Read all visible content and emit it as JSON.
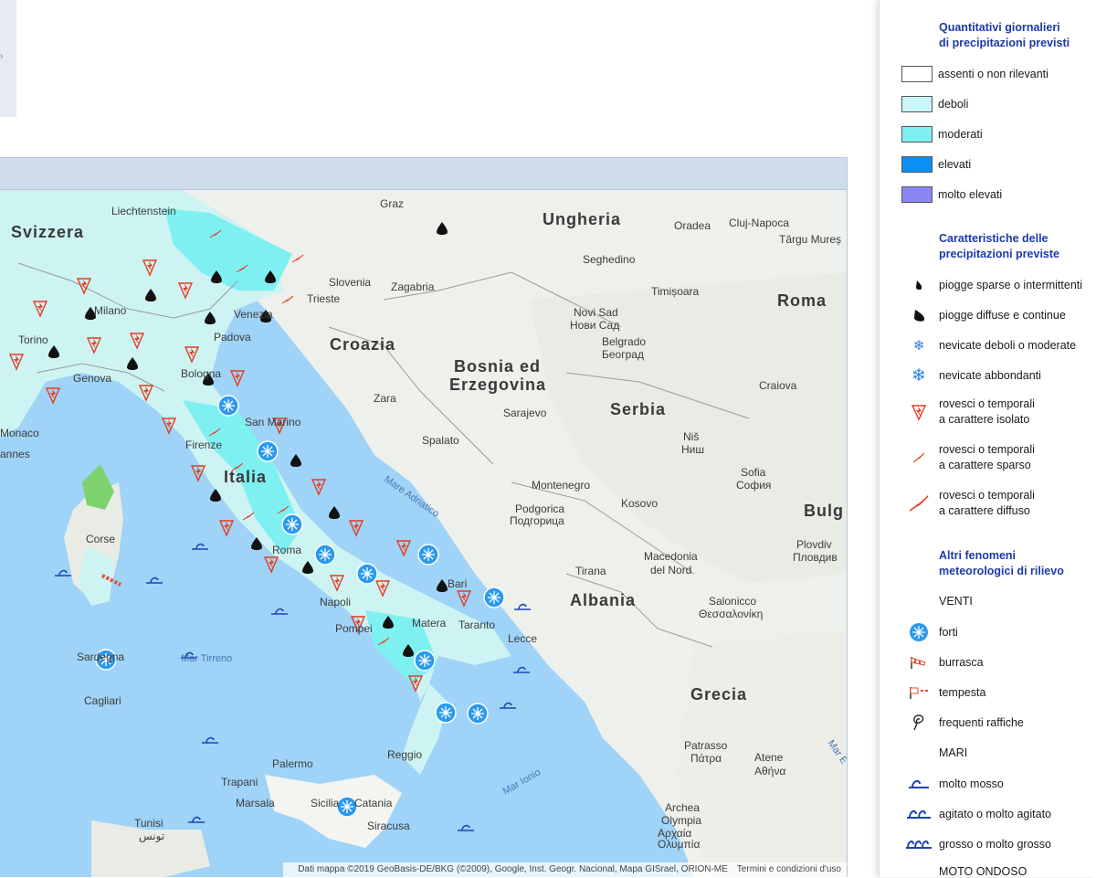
{
  "legend": {
    "quantity_title_1": "Quantitativi giornalieri",
    "quantity_title_2": "di precipitazioni previsti",
    "quantity_items": [
      {
        "label": "assenti o non rilevanti",
        "color": "#ffffff"
      },
      {
        "label": "deboli",
        "color": "#c9f6f8"
      },
      {
        "label": "moderati",
        "color": "#7ff0f2"
      },
      {
        "label": "elevati",
        "color": "#0b8ff2"
      },
      {
        "label": "molto elevati",
        "color": "#8a86f2"
      }
    ],
    "features_title_1": "Caratteristiche delle",
    "features_title_2": "precipitazioni previste",
    "features_items": [
      {
        "icon": "drop-small-icon",
        "line1": "piogge sparse o intermittenti",
        "line2": ""
      },
      {
        "icon": "drop-large-icon",
        "line1": "piogge diffuse e continue",
        "line2": ""
      },
      {
        "icon": "snowflake-small-icon",
        "line1": "nevicate deboli o moderate",
        "line2": ""
      },
      {
        "icon": "snowflake-large-icon",
        "line1": "nevicate abbondanti",
        "line2": ""
      },
      {
        "icon": "thunder-isolated-icon",
        "line1": "rovesci o temporali",
        "line2": "a carattere isolato"
      },
      {
        "icon": "thunder-scattered-icon",
        "line1": "rovesci o temporali",
        "line2": "a carattere sparso"
      },
      {
        "icon": "thunder-diffuse-icon",
        "line1": "rovesci o temporali",
        "line2": "a carattere diffuso"
      }
    ],
    "other_title_1": "Altri fenomeni",
    "other_title_2": "meteorologici di rilievo",
    "winds_label": "VENTI",
    "winds_items": [
      {
        "icon": "strong-wind-icon",
        "label": "forti"
      },
      {
        "icon": "windsock-gale-icon",
        "label": "burrasca"
      },
      {
        "icon": "windsock-storm-icon",
        "label": "tempesta"
      },
      {
        "icon": "gusts-icon",
        "label": "frequenti raffiche"
      }
    ],
    "seas_label": "MARI",
    "seas_items": [
      {
        "icon": "sea-rough-icon",
        "label": "molto mosso"
      },
      {
        "icon": "sea-very-rough-icon",
        "label": "agitato o molto agitato"
      },
      {
        "icon": "sea-high-icon",
        "label": "grosso o molto grosso"
      }
    ],
    "waves_label": "MOTO ONDOSO"
  },
  "map": {
    "attribution": "Dati mappa ©2019 GeoBasis-DE/BKG (©2009), Google, Inst. Geogr. Nacional, Mapa GISrael, ORION-ME",
    "terms": "Termini e condizioni d'uso",
    "labels": {
      "liechtenstein": "Liechtenstein",
      "svizzera": "Svizzera",
      "graz": "Graz",
      "ungheria": "Ungheria",
      "oradea": "Oradea",
      "cluj": "Cluj-Napoca",
      "targu": "Târgu Mureș",
      "seghedino": "Seghedino",
      "slovenia": "Slovenia",
      "zagabria": "Zagabria",
      "trieste": "Trieste",
      "timisoara": "Timișoara",
      "romania": "Roma",
      "milano": "Milano",
      "padova": "Padova",
      "venezia": "Venezia",
      "torino": "Torino",
      "genova": "Genova",
      "bologna": "Bologna",
      "croazia": "Croazia",
      "novisad": "Novi Sad",
      "novisad_cyr": "Нови Сад",
      "belgrado": "Belgrado",
      "belgrado_cyr": "Београд",
      "bosnia1": "Bosnia ed",
      "bosnia2": "Erzegovina",
      "craiova": "Craiova",
      "zara": "Zara",
      "sarajevo": "Sarajevo",
      "serbia": "Serbia",
      "monaco": "Monaco",
      "cannes": "annes",
      "sanmarino": "San Marino",
      "firenze": "Firenze",
      "italia": "Italia",
      "spalato": "Spalato",
      "mareadriatico": "Mare Adriatico",
      "nis": "Niš",
      "nis_cyr": "Ниш",
      "sofia": "Sofia",
      "sofia_cyr": "София",
      "montenegro": "Montenegro",
      "kosovo": "Kosovo",
      "podgorica": "Podgorica",
      "podgorica_cyr": "Подгорица",
      "bulg": "Bulg",
      "plovdiv": "Plovdiv",
      "plovdiv_cyr": "Пловдив",
      "corse": "Corse",
      "roma": "Roma",
      "bari": "Bari",
      "tirana": "Tirana",
      "albania": "Albania",
      "macedonia1": "Macedonia",
      "macedonia2": "del Nord",
      "salonicco": "Salonicco",
      "salonicco_gr": "Θεσσαλονίκη",
      "napoli": "Napoli",
      "pompei": "Pompei",
      "matera": "Matera",
      "taranto": "Taranto",
      "lecce": "Lecce",
      "sardegna": "Sardegna",
      "mar_tirreno": "Mar Tirreno",
      "cagliari": "Cagliari",
      "grecia": "Grecia",
      "patrasso": "Patrasso",
      "patrasso_gr": "Πάτρα",
      "atene": "Atene",
      "atene_gr": "Αθήνα",
      "mar_ionio": "Mar Ionio",
      "palermo": "Palermo",
      "reggio": "Reggio",
      "trapani": "Trapani",
      "marsala": "Marsala",
      "sicilia": "Sicilia",
      "catania": "Catania",
      "siracusa": "Siracusa",
      "archea": "Archea",
      "olympia": "Olympia",
      "olympia_gr": "Αρχαία",
      "olympia_gr2": "Ολυμπία",
      "tunisi": "Tunisi",
      "tunisi_ar": "تونس",
      "mar_egeo": "Mar E"
    }
  }
}
